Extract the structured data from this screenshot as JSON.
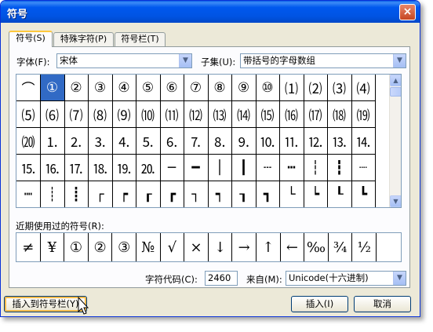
{
  "window": {
    "title": "符号",
    "close_glyph": "×"
  },
  "tabs": [
    {
      "label": "符号(S)"
    },
    {
      "label": "特殊字符(P)"
    },
    {
      "label": "符号栏(T)"
    }
  ],
  "font": {
    "label": "字体(F):",
    "value": "宋体"
  },
  "subset": {
    "label": "子集(U):",
    "value": "带括号的字母数组"
  },
  "symbol_grid": {
    "selected_index": 1,
    "cells": [
      "⌒",
      "①",
      "②",
      "③",
      "④",
      "⑤",
      "⑥",
      "⑦",
      "⑧",
      "⑨",
      "⑩",
      "⑴",
      "⑵",
      "⑶",
      "⑷",
      "⑸",
      "⑹",
      "⑺",
      "⑻",
      "⑼",
      "⑽",
      "⑾",
      "⑿",
      "⒀",
      "⒁",
      "⒂",
      "⒃",
      "⒄",
      "⒅",
      "⒆",
      "⒇",
      "⒈",
      "⒉",
      "⒊",
      "⒋",
      "⒌",
      "⒍",
      "⒎",
      "⒏",
      "⒐",
      "⒑",
      "⒒",
      "⒓",
      "⒔",
      "⒕",
      "⒖",
      "⒗",
      "⒘",
      "⒙",
      "⒚",
      "⒛",
      "─",
      "━",
      "│",
      "┃",
      "┄",
      "┅",
      "┆",
      "┇",
      "┈",
      "┉",
      "┊",
      "┋",
      "┌",
      "┍",
      "┎",
      "┏",
      "┐",
      "┑",
      "┒",
      "┓",
      "└",
      "┕",
      "┖",
      "┗"
    ]
  },
  "recent": {
    "label": "近期使用过的符号(R):",
    "symbols": [
      "≠",
      "¥",
      "①",
      "②",
      "③",
      "№",
      "√",
      "×",
      "↓",
      "→",
      "↑",
      "←",
      "‰",
      "¾",
      "½"
    ]
  },
  "char_code": {
    "label": "字符代码(C):",
    "value": "2460"
  },
  "from": {
    "label": "来自(M):",
    "value": "Unicode(十六进制)"
  },
  "buttons": {
    "insert_to_bar": "插入到符号栏(Y)",
    "insert": "插入(I)",
    "cancel": "取消"
  },
  "icons": {
    "close": "close-icon",
    "dropdown": "chevron-down-icon",
    "scroll_up": "scroll-up-icon",
    "scroll_down": "scroll-down-icon",
    "cursor": "mouse-pointer-icon"
  },
  "colors": {
    "title_bar": "#0054e3",
    "selection": "#316ac5",
    "dialog_bg": "#ece9d8"
  }
}
